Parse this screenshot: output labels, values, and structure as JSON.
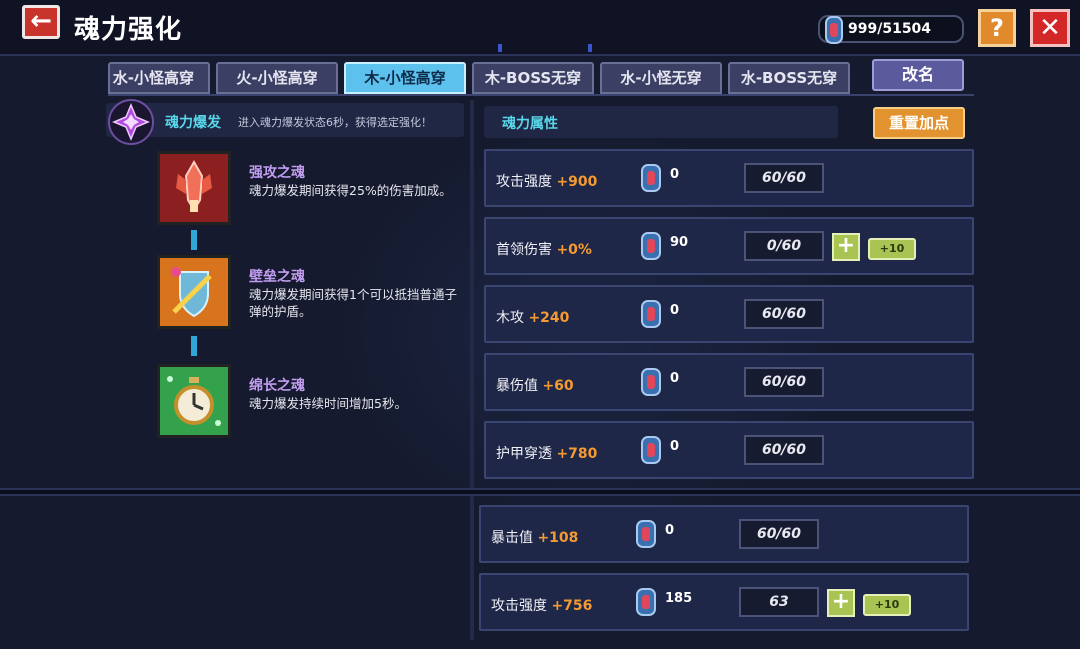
{
  "header": {
    "back_icon": "back-arrow-icon",
    "title": "魂力强化",
    "currency": "999/51504",
    "help_label": "?",
    "close_label": "✕"
  },
  "tabs": [
    {
      "label": "水-小怪高穿",
      "active": false
    },
    {
      "label": "火-小怪高穿",
      "active": false
    },
    {
      "label": "木-小怪高穿",
      "active": true
    },
    {
      "label": "木-BOSS无穿",
      "active": false
    },
    {
      "label": "水-小怪无穿",
      "active": false
    },
    {
      "label": "水-BOSS无穿",
      "active": false
    }
  ],
  "rename_label": "改名",
  "burst": {
    "label": "魂力爆发",
    "desc": "进入魂力爆发状态6秒，获得选定强化！"
  },
  "skills": [
    {
      "name": "强攻之魂",
      "desc": "魂力爆发期间获得25%的伤害加成。",
      "icon": "strength-soul-icon"
    },
    {
      "name": "壁垒之魂",
      "desc": "魂力爆发期间获得1个可以抵挡普通子弹的护盾。",
      "icon": "shield-soul-icon"
    },
    {
      "name": "绵长之魂",
      "desc": "魂力爆发持续时间增加5秒。",
      "icon": "stopwatch-soul-icon"
    }
  ],
  "attributes": {
    "title": "魂力属性",
    "reset_label": "重置加点"
  },
  "rows": [
    {
      "name": "攻击强度",
      "bonus": "+900",
      "cost": "0",
      "level": "60/60",
      "plus": false
    },
    {
      "name": "首领伤害",
      "bonus": "+0%",
      "cost": "90",
      "level": "0/60",
      "plus": true
    },
    {
      "name": "木攻",
      "bonus": "+240",
      "cost": "0",
      "level": "60/60",
      "plus": false
    },
    {
      "name": "暴伤值",
      "bonus": "+60",
      "cost": "0",
      "level": "60/60",
      "plus": false
    },
    {
      "name": "护甲穿透",
      "bonus": "+780",
      "cost": "0",
      "level": "60/60",
      "plus": false
    },
    {
      "name": "暴击值",
      "bonus": "+108",
      "cost": "0",
      "level": "60/60",
      "plus": false
    },
    {
      "name": "攻击强度",
      "bonus": "+756",
      "cost": "185",
      "level": "63",
      "plus": true
    }
  ],
  "plus_label": "+",
  "plus10_label": "+10",
  "colors": {
    "accent_cyan": "#58d8ea",
    "bonus_orange": "#f39a32",
    "skill_purple": "#c29ef0",
    "close_red": "#d42828",
    "help_orange": "#e08a2c"
  }
}
